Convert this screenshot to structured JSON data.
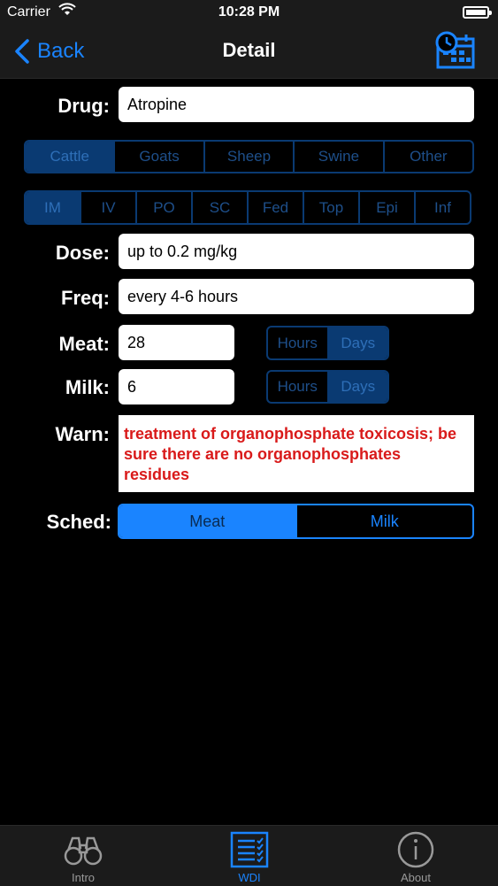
{
  "status_bar": {
    "carrier": "Carrier",
    "time": "10:28 PM"
  },
  "nav": {
    "back_label": "Back",
    "title": "Detail"
  },
  "form": {
    "drug_label": "Drug:",
    "drug_value": "Atropine",
    "species": [
      "Cattle",
      "Goats",
      "Sheep",
      "Swine",
      "Other"
    ],
    "species_selected": "Cattle",
    "routes": [
      "IM",
      "IV",
      "PO",
      "SC",
      "Fed",
      "Top",
      "Epi",
      "Inf"
    ],
    "route_selected": "IM",
    "dose_label": "Dose:",
    "dose_value": "up to 0.2 mg/kg",
    "freq_label": "Freq:",
    "freq_value": "every 4-6 hours",
    "meat_label": "Meat:",
    "meat_value": "28",
    "meat_units": [
      "Hours",
      "Days"
    ],
    "meat_unit_selected": "Days",
    "milk_label": "Milk:",
    "milk_value": "6",
    "milk_units": [
      "Hours",
      "Days"
    ],
    "milk_unit_selected": "Days",
    "warn_label": "Warn:",
    "warn_text": " treatment of organophosphate toxicosis; be sure there are no organophosphates residues",
    "sched_label": "Sched:",
    "sched_options": [
      "Meat",
      "Milk"
    ],
    "sched_selected": "Meat"
  },
  "tabs": [
    {
      "label": "Intro",
      "icon": "binoculars-icon"
    },
    {
      "label": "WDI",
      "icon": "checklist-icon"
    },
    {
      "label": "About",
      "icon": "info-icon"
    }
  ],
  "active_tab": "WDI",
  "colors": {
    "accent": "#1a84ff",
    "segment_dark": "#0a3a72",
    "warning": "#d91a1a"
  }
}
